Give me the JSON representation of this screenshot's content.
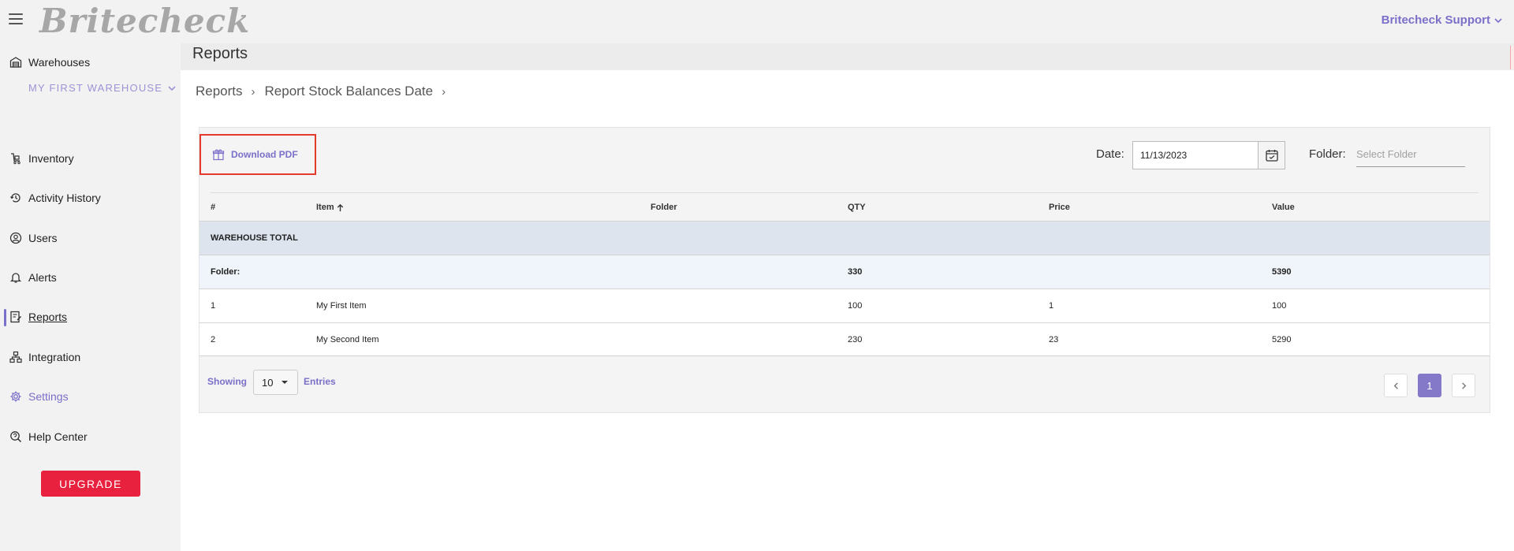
{
  "app": {
    "logo": "Britecheck",
    "user_menu": "Britecheck Support"
  },
  "sidebar": {
    "warehouses_label": "Warehouses",
    "warehouse_selected": "MY FIRST WAREHOUSE",
    "items": [
      {
        "label": "Inventory",
        "icon": "inventory-icon"
      },
      {
        "label": "Activity History",
        "icon": "history-icon"
      },
      {
        "label": "Users",
        "icon": "user-icon"
      },
      {
        "label": "Alerts",
        "icon": "bell-icon"
      },
      {
        "label": "Reports",
        "icon": "report-icon",
        "active": true
      },
      {
        "label": "Integration",
        "icon": "integration-icon"
      },
      {
        "label": "Settings",
        "icon": "gear-icon"
      },
      {
        "label": "Help Center",
        "icon": "help-icon"
      }
    ],
    "upgrade_label": "UPGRADE"
  },
  "page": {
    "title": "Reports"
  },
  "breadcrumb": [
    "Reports",
    "Report Stock Balances Date"
  ],
  "toolbar": {
    "download_label": "Download PDF",
    "date_label": "Date:",
    "date_value": "11/13/2023",
    "folder_label": "Folder:",
    "folder_placeholder": "Select Folder"
  },
  "table": {
    "columns": [
      "#",
      "Item",
      "Folder",
      "QTY",
      "Price",
      "Value"
    ],
    "sort_column": "Item",
    "sort_direction": "ascending",
    "warehouse_total_label": "WAREHOUSE TOTAL",
    "folder_row": {
      "label": "Folder:",
      "qty": "330",
      "value": "5390"
    },
    "rows": [
      {
        "num": "1",
        "item": "My First Item",
        "folder": "",
        "qty": "100",
        "price": "1",
        "value": "100"
      },
      {
        "num": "2",
        "item": "My Second Item",
        "folder": "",
        "qty": "230",
        "price": "23",
        "value": "5290"
      }
    ]
  },
  "footer": {
    "showing_label": "Showing",
    "page_size": "10",
    "entries_label": "Entries",
    "current_page": "1"
  },
  "colors": {
    "accent": "#7a6fc9",
    "upgrade": "#e8213f",
    "highlight_box": "#e53a2b"
  }
}
